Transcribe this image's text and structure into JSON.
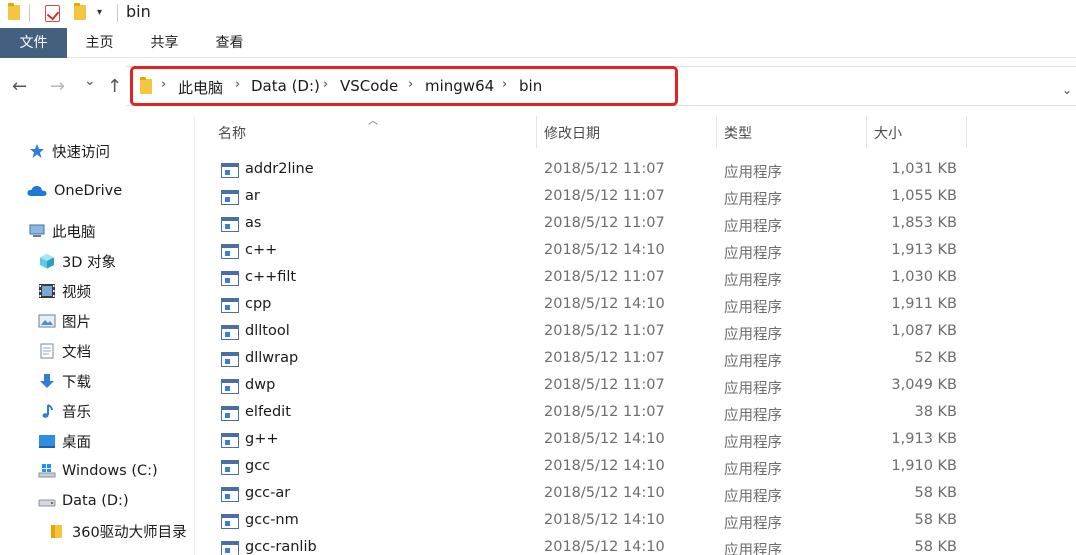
{
  "window": {
    "title": "bin"
  },
  "ribbon": {
    "tabs": [
      "文件",
      "主页",
      "共享",
      "查看"
    ]
  },
  "nav": {
    "back": "←",
    "forward": "→",
    "recent": "⌄",
    "up": "↑",
    "breadcrumb": [
      "此电脑",
      "Data (D:)",
      "VSCode",
      "mingw64",
      "bin"
    ],
    "separator": "›",
    "address_dropdown": "⌄"
  },
  "sidebar": {
    "items": [
      {
        "label": "快速访问",
        "icon": "star-icon"
      },
      {
        "label": "OneDrive",
        "icon": "cloud-icon"
      },
      {
        "label": "此电脑",
        "icon": "computer-icon"
      },
      {
        "label": "3D 对象",
        "icon": "cube-icon"
      },
      {
        "label": "视频",
        "icon": "film-icon"
      },
      {
        "label": "图片",
        "icon": "picture-icon"
      },
      {
        "label": "文档",
        "icon": "document-icon"
      },
      {
        "label": "下载",
        "icon": "download-icon"
      },
      {
        "label": "音乐",
        "icon": "music-icon"
      },
      {
        "label": "桌面",
        "icon": "desktop-icon"
      },
      {
        "label": "Windows (C:)",
        "icon": "windows-drive-icon"
      },
      {
        "label": "Data (D:)",
        "icon": "drive-icon"
      },
      {
        "label": "360驱动大师目录",
        "icon": "folder-icon"
      }
    ]
  },
  "table": {
    "headers": {
      "name": "名称",
      "date": "修改日期",
      "type": "类型",
      "size": "大小"
    },
    "rows": [
      {
        "name": "addr2line",
        "date": "2018/5/12 11:07",
        "type": "应用程序",
        "size": "1,031 KB"
      },
      {
        "name": "ar",
        "date": "2018/5/12 11:07",
        "type": "应用程序",
        "size": "1,055 KB"
      },
      {
        "name": "as",
        "date": "2018/5/12 11:07",
        "type": "应用程序",
        "size": "1,853 KB"
      },
      {
        "name": "c++",
        "date": "2018/5/12 14:10",
        "type": "应用程序",
        "size": "1,913 KB"
      },
      {
        "name": "c++filt",
        "date": "2018/5/12 11:07",
        "type": "应用程序",
        "size": "1,030 KB"
      },
      {
        "name": "cpp",
        "date": "2018/5/12 14:10",
        "type": "应用程序",
        "size": "1,911 KB"
      },
      {
        "name": "dlltool",
        "date": "2018/5/12 11:07",
        "type": "应用程序",
        "size": "1,087 KB"
      },
      {
        "name": "dllwrap",
        "date": "2018/5/12 11:07",
        "type": "应用程序",
        "size": "52 KB"
      },
      {
        "name": "dwp",
        "date": "2018/5/12 11:07",
        "type": "应用程序",
        "size": "3,049 KB"
      },
      {
        "name": "elfedit",
        "date": "2018/5/12 11:07",
        "type": "应用程序",
        "size": "38 KB"
      },
      {
        "name": "g++",
        "date": "2018/5/12 14:10",
        "type": "应用程序",
        "size": "1,913 KB"
      },
      {
        "name": "gcc",
        "date": "2018/5/12 14:10",
        "type": "应用程序",
        "size": "1,910 KB"
      },
      {
        "name": "gcc-ar",
        "date": "2018/5/12 14:10",
        "type": "应用程序",
        "size": "58 KB"
      },
      {
        "name": "gcc-nm",
        "date": "2018/5/12 14:10",
        "type": "应用程序",
        "size": "58 KB"
      },
      {
        "name": "gcc-ranlib",
        "date": "2018/5/12 14:10",
        "type": "应用程序",
        "size": "58 KB"
      }
    ]
  },
  "colors": {
    "file_tab": "#44607f",
    "highlight_box": "#e02424"
  }
}
